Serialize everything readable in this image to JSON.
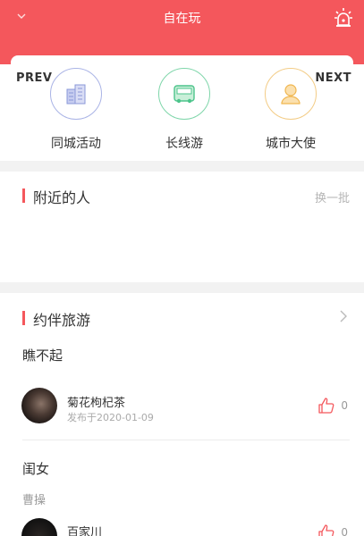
{
  "header": {
    "title": "自在玩",
    "bg_color": "#f4575c",
    "left_icon": "chevron-down-icon",
    "right_icon": "alarm-light-icon"
  },
  "carousel": {
    "prev_label": "PREV",
    "next_label": "NEXT"
  },
  "categories": [
    {
      "label": "同城活动",
      "icon": "buildings-icon",
      "color": "#8a98d8"
    },
    {
      "label": "长线游",
      "icon": "bus-icon",
      "color": "#4cc48b"
    },
    {
      "label": "城市大使",
      "icon": "person-icon",
      "color": "#f0b64f"
    }
  ],
  "nearby": {
    "title": "附近的人",
    "refresh_label": "换一批"
  },
  "travel": {
    "title": "约伴旅游",
    "posts": [
      {
        "title": "瞧不起",
        "subtitle": "",
        "user": "菊花枸杞茶",
        "date": "发布于2020-01-09",
        "likes": "0"
      },
      {
        "title": "闺女",
        "subtitle": "曹操",
        "user": "百家川",
        "date": "",
        "likes": "0"
      }
    ]
  }
}
